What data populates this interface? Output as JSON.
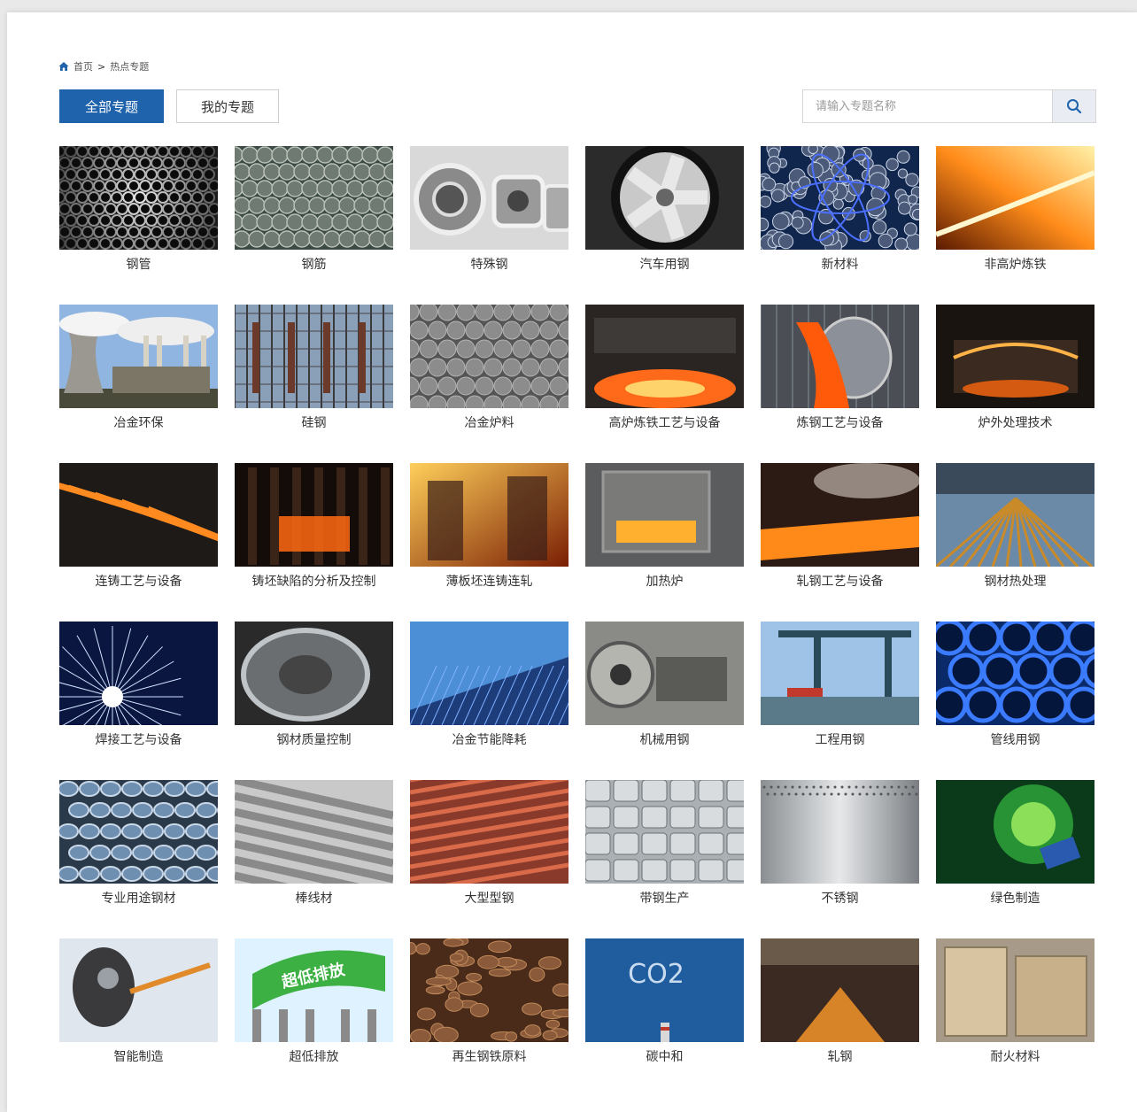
{
  "breadcrumb": {
    "home": "首页",
    "separator": ">",
    "current": "热点专题",
    "icon": "home-icon"
  },
  "tabs": {
    "all": "全部专题",
    "mine": "我的专题"
  },
  "search": {
    "placeholder": "请输入专题名称",
    "value": "",
    "icon": "search-icon"
  },
  "colors": {
    "accent": "#1f63ad",
    "text": "#333333"
  },
  "topics": [
    {
      "label": "钢管",
      "theme": "pipes"
    },
    {
      "label": "钢筋",
      "theme": "rebar"
    },
    {
      "label": "特殊钢",
      "theme": "bearing"
    },
    {
      "label": "汽车用钢",
      "theme": "wheel"
    },
    {
      "label": "新材料",
      "theme": "atom"
    },
    {
      "label": "非高炉炼铁",
      "theme": "sparks"
    },
    {
      "label": "冶金环保",
      "theme": "plant"
    },
    {
      "label": "硅钢",
      "theme": "grid"
    },
    {
      "label": "冶金炉料",
      "theme": "balls"
    },
    {
      "label": "高炉炼铁工艺与设备",
      "theme": "furnace"
    },
    {
      "label": "炼钢工艺与设备",
      "theme": "ladle"
    },
    {
      "label": "炉外处理技术",
      "theme": "furnace2"
    },
    {
      "label": "连铸工艺与设备",
      "theme": "casting"
    },
    {
      "label": "铸坯缺陷的分析及控制",
      "theme": "castdark"
    },
    {
      "label": "薄板坯连铸连轧",
      "theme": "hotmill"
    },
    {
      "label": "加热炉",
      "theme": "reheat"
    },
    {
      "label": "轧钢工艺与设备",
      "theme": "plate"
    },
    {
      "label": "钢材热处理",
      "theme": "hall"
    },
    {
      "label": "焊接工艺与设备",
      "theme": "weld"
    },
    {
      "label": "钢材质量控制",
      "theme": "roll"
    },
    {
      "label": "冶金节能降耗",
      "theme": "solar"
    },
    {
      "label": "机械用钢",
      "theme": "lathe"
    },
    {
      "label": "工程用钢",
      "theme": "bridge"
    },
    {
      "label": "管线用钢",
      "theme": "bluepipes"
    },
    {
      "label": "专业用途钢材",
      "theme": "flanges"
    },
    {
      "label": "棒线材",
      "theme": "bars"
    },
    {
      "label": "大型型钢",
      "theme": "beams"
    },
    {
      "label": "带钢生产",
      "theme": "coils"
    },
    {
      "label": "不锈钢",
      "theme": "brushed"
    },
    {
      "label": "绿色制造",
      "theme": "green"
    },
    {
      "label": "智能制造",
      "theme": "robot"
    },
    {
      "label": "超低排放",
      "theme": "emission",
      "art_text": "超低排放"
    },
    {
      "label": "再生钢铁原料",
      "theme": "scrap"
    },
    {
      "label": "碳中和",
      "theme": "co2",
      "art_text": "CO2"
    },
    {
      "label": "轧钢",
      "theme": "rolling"
    },
    {
      "label": "耐火材料",
      "theme": "bricks"
    }
  ]
}
